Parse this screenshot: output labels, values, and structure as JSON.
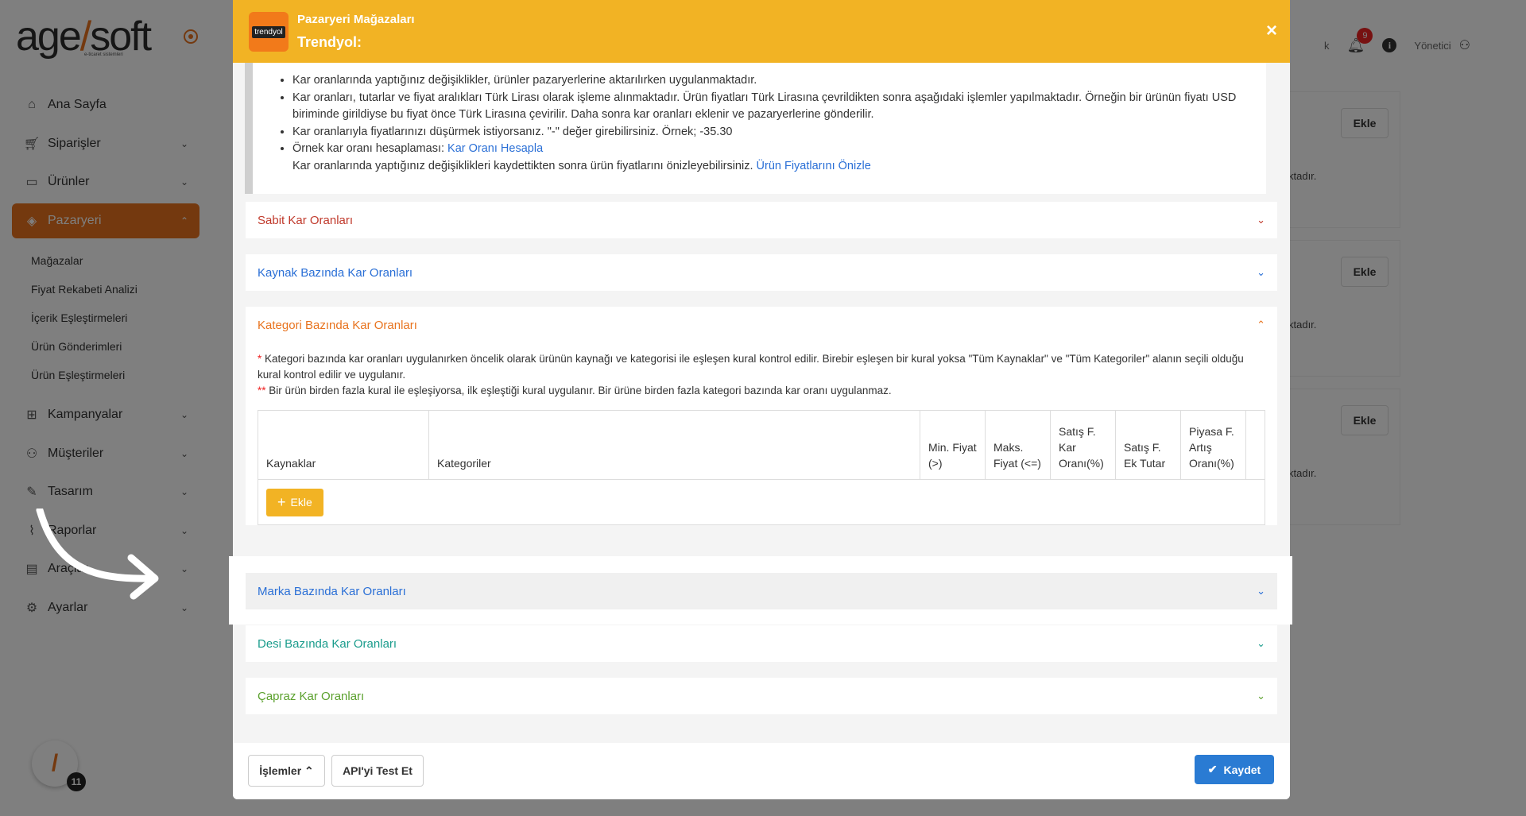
{
  "logo": {
    "text_main": "age",
    "text_accent": "soft",
    "tagline": "e-ticaret sistemleri"
  },
  "sidebar": {
    "items": [
      {
        "label": "Ana Sayfa",
        "icon": "home-icon",
        "has_chevron": false
      },
      {
        "label": "Siparişler",
        "icon": "cart-icon",
        "has_chevron": true
      },
      {
        "label": "Ürünler",
        "icon": "book-icon",
        "has_chevron": true
      },
      {
        "label": "Pazaryeri",
        "icon": "cube-icon",
        "has_chevron": true,
        "active": true
      },
      {
        "label": "Kampanyalar",
        "icon": "basket-icon",
        "has_chevron": true
      },
      {
        "label": "Müşteriler",
        "icon": "user-icon",
        "has_chevron": true
      },
      {
        "label": "Tasarım",
        "icon": "edit-icon",
        "has_chevron": true
      },
      {
        "label": "Raporlar",
        "icon": "chart-icon",
        "has_chevron": true
      },
      {
        "label": "Araçlar",
        "icon": "clipboard-icon",
        "has_chevron": true
      },
      {
        "label": "Ayarlar",
        "icon": "gear-icon",
        "has_chevron": true
      }
    ],
    "sub_items": [
      "Mağazalar",
      "Fiyat Rekabeti Analizi",
      "İçerik Eşleştirmeleri",
      "Ürün Gönderimleri",
      "Ürün Eşleştirmeleri"
    ],
    "fab_badge": "11"
  },
  "topbar": {
    "partial_text": "k",
    "notification_count": "9",
    "user_label": "Yönetici"
  },
  "cards": [
    {
      "button": "Ekle",
      "text": "ktadır."
    },
    {
      "button": "Ekle",
      "text": "ktadır."
    },
    {
      "button": "Ekle",
      "text": "ktadır."
    }
  ],
  "modal": {
    "store_logo_text": "trendyol",
    "title": "Pazaryeri Mağazaları",
    "subtitle": "Trendyol:",
    "close": "×",
    "info": {
      "line1": "Kar oranlarında yaptığınız değişiklikler, ürünler pazaryerlerine aktarılırken uygulanmaktadır.",
      "line2": "Kar oranları, tutarlar ve fiyat aralıkları Türk Lirası olarak işleme alınmaktadır. Ürün fiyatları Türk Lirasına çevrildikten sonra aşağıdaki işlemler yapılmaktadır. Örneğin bir ürünün fiyatı USD biriminde girildiyse bu fiyat önce Türk Lirasına çevirilir. Daha sonra kar oranları eklenir ve pazaryerlerine gönderilir.",
      "line3": "Kar oranlarıyla fiyatlarınızı düşürmek istiyorsanız. \"-\" değer girebilirsiniz. Örnek; -35.30",
      "line4_prefix": "Örnek kar oranı hesaplaması: ",
      "line4_link": "Kar Oranı Hesapla",
      "line5_prefix": "Kar oranlarında yaptığınız değişiklikleri kaydettikten sonra ürün fiyatlarını önizleyebilirsiniz. ",
      "line5_link": "Ürün Fiyatlarını Önizle"
    },
    "sections": {
      "sabit": "Sabit Kar Oranları",
      "kaynak": "Kaynak Bazında Kar Oranları",
      "kategori": "Kategori Bazında Kar Oranları",
      "marka": "Marka Bazında Kar Oranları",
      "desi": "Desi Bazında Kar Oranları",
      "capraz": "Çapraz Kar Oranları"
    },
    "section_colors": {
      "sabit": "#c0392b",
      "kaynak": "#2a6fd6",
      "kategori": "#e8731e",
      "marka": "#2a6fd6",
      "desi": "#1a9c8c",
      "capraz": "#5aa02c"
    },
    "category": {
      "note1_star": "*",
      "note1": " Kategori bazında kar oranları uygulanırken öncelik olarak ürünün kaynağı ve kategorisi ile eşleşen kural kontrol edilir. Birebir eşleşen bir kural yoksa \"Tüm Kaynaklar\" ve \"Tüm Kategoriler\" alanın seçili olduğu kural kontrol edilir ve uygulanır.",
      "note2_star": "**",
      "note2": " Bir ürün birden fazla kural ile eşleşiyorsa, ilk eşleştiği kural uygulanır. Bir ürüne birden fazla kategori bazında kar oranı uygulanmaz.",
      "columns": [
        "Kaynaklar",
        "Kategoriler",
        "Min. Fiyat (>)",
        "Maks. Fiyat (<=)",
        "Satış F. Kar Oranı(%)",
        "Satış F. Ek Tutar",
        "Piyasa F. Artış Oranı(%)",
        ""
      ],
      "add_button": "Ekle"
    },
    "footer": {
      "actions": "İşlemler",
      "api_test": "API'yi Test Et",
      "save": "Kaydet"
    }
  }
}
